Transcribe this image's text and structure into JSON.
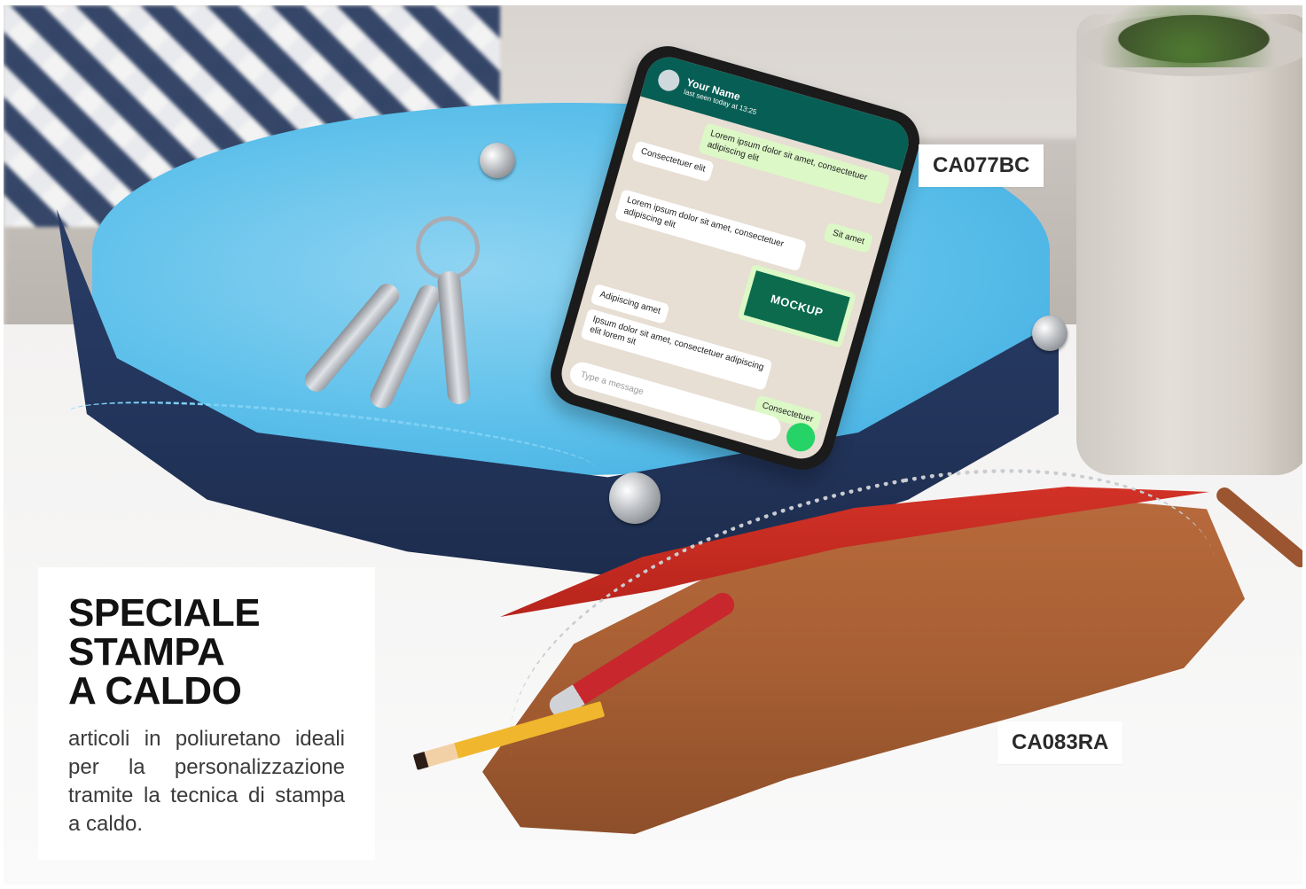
{
  "labels": {
    "tray_code": "CA077BC",
    "case_code": "CA083RA"
  },
  "promo": {
    "title_lines": [
      "SPECIALE",
      "STAMPA",
      "A CALDO"
    ],
    "description": "articoli in poliuretano ideali per la personalizzazione tramite la tecnica di stampa a caldo."
  },
  "phone": {
    "contact_name": "Your Name",
    "contact_status": "last seen today at 13:25",
    "messages": [
      {
        "direction": "out",
        "text": "Lorem ipsum dolor sit amet, consectetuer adipiscing elit"
      },
      {
        "direction": "in",
        "text": "Consectetuer elit"
      },
      {
        "direction": "out",
        "text": "Sit amet"
      },
      {
        "direction": "in",
        "text": "Lorem ipsum dolor sit amet, consectetuer adipiscing elit"
      },
      {
        "direction": "in",
        "text": "Adipiscing amet"
      },
      {
        "direction": "in",
        "text": "Ipsum dolor sit amet, consectetuer adipiscing elit lorem sit"
      },
      {
        "direction": "out",
        "text": "Consectetuer"
      }
    ],
    "logo_text": "MOCKUP",
    "input_placeholder": "Type a message"
  },
  "colors": {
    "tray_inner": "#5bbfea",
    "tray_outer": "#22345a",
    "case_outer": "#a85f33",
    "case_inner": "#d23227",
    "whatsapp_header": "#075e54"
  },
  "icons": {
    "snap": "snap-button-icon",
    "mic": "mic-icon"
  }
}
